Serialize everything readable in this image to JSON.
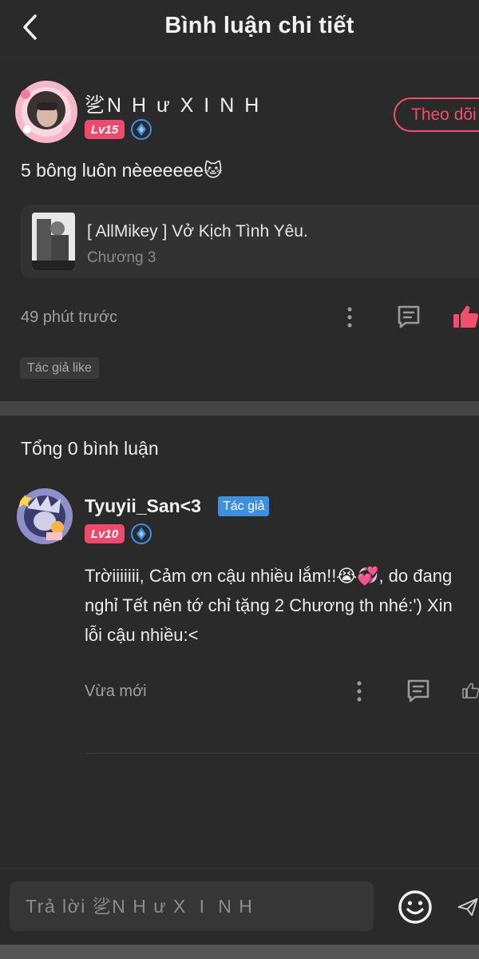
{
  "header": {
    "title": "Bình luận chi tiết"
  },
  "post": {
    "username": "乷N H ư X  I  N H",
    "level": "Lv15",
    "follow_label": "Theo dõi",
    "text": "5 bông luôn nèeeeeee🐱",
    "book": {
      "title": "[ AllMikey ] Vở Kịch Tình Yêu.",
      "chapter": "Chương 3"
    },
    "time": "49 phút trước",
    "author_like_tag": "Tác giả like"
  },
  "comments": {
    "total_label": "Tổng 0 bình luận",
    "items": [
      {
        "name": "Tyuyii_San<3",
        "tag": "Tác giả",
        "level": "Lv10",
        "text": "Trờiiiiiii, Cảm ơn cậu nhiều lắm!!😭💞, do đang nghỉ Tết nên tớ chỉ tặng 2 Chương th nhé:') Xin lỗi cậu nhiều:<",
        "time": "Vừa mới"
      }
    ]
  },
  "reply": {
    "placeholder": "Trả lời 乷N H ư X  I  N H"
  },
  "colors": {
    "background": "#2a2a2a",
    "accent": "#f0506e",
    "level_badge": "#ee4a6d",
    "author_tag": "#3e8fe0",
    "verify": "#3b8eea"
  },
  "icons": [
    "back-arrow-icon",
    "verified-icon",
    "more-icon",
    "comment-icon",
    "thumbs-up-icon",
    "emoji-icon",
    "send-icon"
  ]
}
